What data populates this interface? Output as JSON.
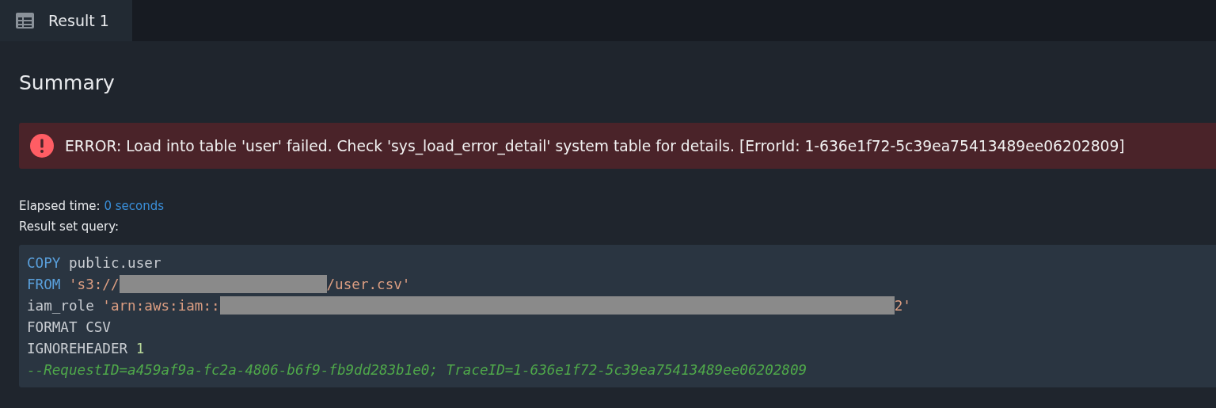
{
  "tabs": [
    {
      "label": "Result 1",
      "selected": true
    }
  ],
  "summary": {
    "title": "Summary",
    "alert": {
      "kind": "error",
      "message": "ERROR: Load into table 'user' failed. Check 'sys_load_error_detail' system table for details. [ErrorId: 1-636e1f72-5c39ea75413489ee06202809]"
    },
    "elapsed": {
      "label": "Elapsed time:",
      "value": "0 seconds"
    },
    "query_label": "Result set query:",
    "query_lines": [
      [
        {
          "kind": "keyword",
          "text": "COPY"
        },
        {
          "kind": "plain",
          "text": " public.user"
        }
      ],
      [
        {
          "kind": "keyword",
          "text": "FROM"
        },
        {
          "kind": "string",
          "text": " 's3://"
        },
        {
          "kind": "redaction"
        },
        {
          "kind": "string",
          "text": "/user.csv'"
        }
      ],
      [
        {
          "kind": "plain",
          "text": "iam_role "
        },
        {
          "kind": "string",
          "text": "'arn:aws:iam::"
        },
        {
          "kind": "redaction"
        },
        {
          "kind": "string",
          "text": "2'"
        }
      ],
      [
        {
          "kind": "plain",
          "text": "FORMAT CSV"
        }
      ],
      [
        {
          "kind": "plain",
          "text": "IGNOREHEADER "
        },
        {
          "kind": "number",
          "text": "1"
        }
      ],
      [
        {
          "kind": "comment",
          "text": "--RequestID=a459af9a-fc2a-4806-b6f9-fb9dd283b1e0; TraceID=1-636e1f72-5c39ea75413489ee06202809"
        }
      ]
    ]
  }
}
